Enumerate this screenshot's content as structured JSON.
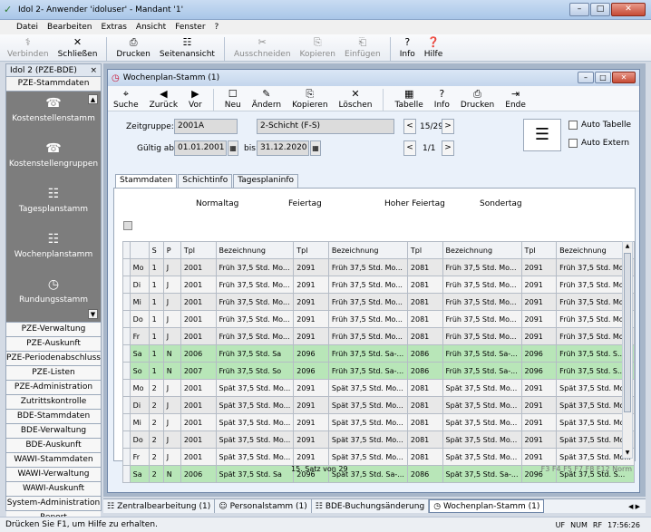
{
  "window": {
    "title": "Idol 2- Anwender 'idoluser' - Mandant '1'",
    "buttons": [
      "–",
      "□",
      "✕"
    ]
  },
  "menu": [
    "Datei",
    "Bearbeiten",
    "Extras",
    "Ansicht",
    "Fenster",
    "?"
  ],
  "toolbar": [
    {
      "label": "Verbinden",
      "icon": "⚕",
      "disabled": true
    },
    {
      "label": "Schließen",
      "icon": "✕",
      "disabled": false
    },
    {
      "label": "Drucken",
      "icon": "⎙",
      "disabled": false
    },
    {
      "label": "Seitenansicht",
      "icon": "☷",
      "disabled": false
    },
    {
      "label": "Ausschneiden",
      "icon": "✂",
      "disabled": true
    },
    {
      "label": "Kopieren",
      "icon": "⎘",
      "disabled": true
    },
    {
      "label": "Einfügen",
      "icon": "⎗",
      "disabled": true
    },
    {
      "label": "Info",
      "icon": "?",
      "disabled": false
    },
    {
      "label": "Hilfe",
      "icon": "❓",
      "disabled": false
    }
  ],
  "left": {
    "header": "Idol 2 (PZE-BDE)",
    "close": "×",
    "section": "PZE-Stammdaten",
    "icons": [
      {
        "label": "Kostenstellenstamm",
        "icon": "☎"
      },
      {
        "label": "Kostenstellengruppen",
        "icon": "☎"
      },
      {
        "label": "Tagesplanstamm",
        "icon": "☷"
      },
      {
        "label": "Wochenplanstamm",
        "icon": "☷"
      },
      {
        "label": "Rundungsstamm",
        "icon": "◷"
      }
    ],
    "items": [
      "PZE-Verwaltung",
      "PZE-Auskunft",
      "PZE-Periodenabschluss",
      "PZE-Listen",
      "PZE-Administration",
      "Zutrittskontrolle",
      "BDE-Stammdaten",
      "BDE-Verwaltung",
      "BDE-Auskunft",
      "WAWI-Stammdaten",
      "WAWI-Verwaltung",
      "WAWI-Auskunft",
      "System-Administration",
      "Report"
    ]
  },
  "child": {
    "title": "Wochenplan-Stamm (1)",
    "toolbar": [
      {
        "label": "Suche",
        "icon": "⌖"
      },
      {
        "label": "Zurück",
        "icon": "◀"
      },
      {
        "label": "Vor",
        "icon": "▶"
      },
      {
        "label": "Neu",
        "icon": "☐"
      },
      {
        "label": "Ändern",
        "icon": "✎"
      },
      {
        "label": "Kopieren",
        "icon": "⎘"
      },
      {
        "label": "Löschen",
        "icon": "✕"
      },
      {
        "label": "Tabelle",
        "icon": "▦"
      },
      {
        "label": "Info",
        "icon": "?"
      },
      {
        "label": "Drucken",
        "icon": "⎙"
      },
      {
        "label": "Ende",
        "icon": "⇥"
      }
    ],
    "form": {
      "zeitgruppe_label": "Zeitgruppe:",
      "zeitgruppe_value": "2001A",
      "schicht_value": "2-Schicht (F-S)",
      "nav1": "15/29",
      "gueltig_label": "Gültig ab:",
      "gueltig_value": "01.01.2001",
      "bis_label": "bis:",
      "bis_value": "31.12.2020",
      "nav2": "1/1",
      "prev": "<",
      "next": ">",
      "cal": "▦",
      "auto_tabelle": "Auto Tabelle",
      "auto_extern": "Auto Extern",
      "big_icon": "☰"
    },
    "tabs": [
      "Stammdaten",
      "Schichtinfo",
      "Tagesplaninfo"
    ],
    "groups": [
      "Normaltag",
      "Feiertag",
      "Hoher Feiertag",
      "Sondertag"
    ],
    "columns": [
      "S",
      "P",
      "Tpl",
      "Bezeichnung",
      "Tpl",
      "Bezeichnung",
      "Tpl",
      "Bezeichnung",
      "Tpl",
      "Bezeichnung"
    ],
    "rows": [
      {
        "day": "Mo",
        "s": "1",
        "p": "J",
        "t1": "2001",
        "b1": "Früh 37,5 Std. Mo...",
        "t2": "2091",
        "b2": "Früh 37,5 Std. Mo...",
        "t3": "2081",
        "b3": "Früh 37,5 Std. Mo...",
        "t4": "2091",
        "b4": "Früh 37,5 Std. Mo...",
        "style": "odd"
      },
      {
        "day": "Di",
        "s": "1",
        "p": "J",
        "t1": "2001",
        "b1": "Früh 37,5 Std. Mo...",
        "t2": "2091",
        "b2": "Früh 37,5 Std. Mo...",
        "t3": "2081",
        "b3": "Früh 37,5 Std. Mo...",
        "t4": "2091",
        "b4": "Früh 37,5 Std. Mo...",
        "style": "even"
      },
      {
        "day": "Mi",
        "s": "1",
        "p": "J",
        "t1": "2001",
        "b1": "Früh 37,5 Std. Mo...",
        "t2": "2091",
        "b2": "Früh 37,5 Std. Mo...",
        "t3": "2081",
        "b3": "Früh 37,5 Std. Mo...",
        "t4": "2091",
        "b4": "Früh 37,5 Std. Mo...",
        "style": "odd"
      },
      {
        "day": "Do",
        "s": "1",
        "p": "J",
        "t1": "2001",
        "b1": "Früh 37,5 Std. Mo...",
        "t2": "2091",
        "b2": "Früh 37,5 Std. Mo...",
        "t3": "2081",
        "b3": "Früh 37,5 Std. Mo...",
        "t4": "2091",
        "b4": "Früh 37,5 Std. Mo...",
        "style": "even"
      },
      {
        "day": "Fr",
        "s": "1",
        "p": "J",
        "t1": "2001",
        "b1": "Früh 37,5 Std. Mo...",
        "t2": "2091",
        "b2": "Früh 37,5 Std. Mo...",
        "t3": "2081",
        "b3": "Früh 37,5 Std. Mo...",
        "t4": "2091",
        "b4": "Früh 37,5 Std. Mo...",
        "style": "odd"
      },
      {
        "day": "Sa",
        "s": "1",
        "p": "N",
        "t1": "2006",
        "b1": "Früh 37,5 Std. Sa",
        "t2": "2096",
        "b2": "Früh 37,5 Std. Sa-...",
        "t3": "2086",
        "b3": "Früh 37,5 Std. Sa-...",
        "t4": "2096",
        "b4": "Früh 37,5 Std. S...",
        "style": "green"
      },
      {
        "day": "So",
        "s": "1",
        "p": "N",
        "t1": "2007",
        "b1": "Früh 37,5 Std. So",
        "t2": "2096",
        "b2": "Früh 37,5 Std. Sa-...",
        "t3": "2086",
        "b3": "Früh 37,5 Std. Sa-...",
        "t4": "2096",
        "b4": "Früh 37,5 Std. S...",
        "style": "green"
      },
      {
        "day": "Mo",
        "s": "2",
        "p": "J",
        "t1": "2001",
        "b1": "Spät 37,5 Std. Mo...",
        "t2": "2091",
        "b2": "Spät 37,5 Std. Mo...",
        "t3": "2081",
        "b3": "Spät 37,5 Std. Mo...",
        "t4": "2091",
        "b4": "Spät 37,5 Std. Mo...",
        "style": "even"
      },
      {
        "day": "Di",
        "s": "2",
        "p": "J",
        "t1": "2001",
        "b1": "Spät 37,5 Std. Mo...",
        "t2": "2091",
        "b2": "Spät 37,5 Std. Mo...",
        "t3": "2081",
        "b3": "Spät 37,5 Std. Mo...",
        "t4": "2091",
        "b4": "Spät 37,5 Std. Mo...",
        "style": "odd"
      },
      {
        "day": "Mi",
        "s": "2",
        "p": "J",
        "t1": "2001",
        "b1": "Spät 37,5 Std. Mo...",
        "t2": "2091",
        "b2": "Spät 37,5 Std. Mo...",
        "t3": "2081",
        "b3": "Spät 37,5 Std. Mo...",
        "t4": "2091",
        "b4": "Spät 37,5 Std. Mo...",
        "style": "even"
      },
      {
        "day": "Do",
        "s": "2",
        "p": "J",
        "t1": "2001",
        "b1": "Spät 37,5 Std. Mo...",
        "t2": "2091",
        "b2": "Spät 37,5 Std. Mo...",
        "t3": "2081",
        "b3": "Spät 37,5 Std. Mo...",
        "t4": "2091",
        "b4": "Spät 37,5 Std. Mo...",
        "style": "odd"
      },
      {
        "day": "Fr",
        "s": "2",
        "p": "J",
        "t1": "2001",
        "b1": "Spät 37,5 Std. Mo...",
        "t2": "2091",
        "b2": "Spät 37,5 Std. Mo...",
        "t3": "2081",
        "b3": "Spät 37,5 Std. Mo...",
        "t4": "2091",
        "b4": "Spät 37,5 Std. Mo...",
        "style": "even"
      },
      {
        "day": "Sa",
        "s": "2",
        "p": "N",
        "t1": "2006",
        "b1": "Spät 37,5 Std. Sa",
        "t2": "2096",
        "b2": "Spät 37,5 Std. Sa-...",
        "t3": "2086",
        "b3": "Spät 37,5 Std. Sa-...",
        "t4": "2096",
        "b4": "Spät 37,5 Std. S...",
        "style": "green"
      }
    ],
    "record_status": "15. Satz von 29",
    "function_keys": "F3  F4  F5  F7  F8  F12  Norm"
  },
  "taskbar": [
    {
      "label": "Zentralbearbeitung (1)",
      "icon": "☷",
      "active": false
    },
    {
      "label": "Personalstamm (1)",
      "icon": "☺",
      "active": false
    },
    {
      "label": "BDE-Buchungsänderung",
      "icon": "☷",
      "active": false
    },
    {
      "label": "Wochenplan-Stamm (1)",
      "icon": "◷",
      "active": true
    }
  ],
  "taskbar_nav": "◀ ▶",
  "status": {
    "help": "Drücken Sie F1, um Hilfe zu erhalten.",
    "indicators": [
      "UF",
      "NUM",
      "RF",
      "17:56:26"
    ]
  }
}
